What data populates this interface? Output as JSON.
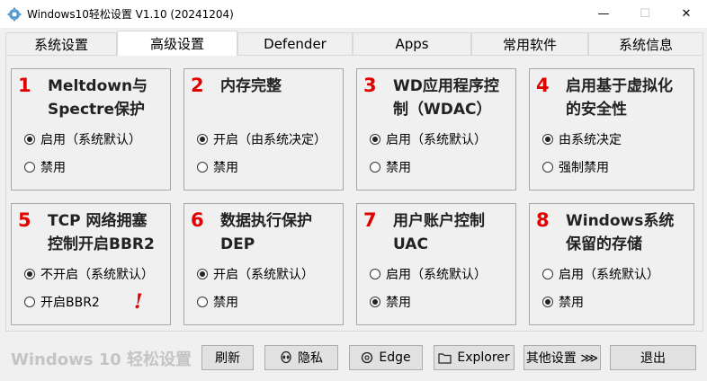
{
  "window": {
    "title": "Windows10轻松设置 V1.10  (20241204)",
    "minimize": "—",
    "maximize": "☐",
    "close": "✕"
  },
  "tabs": [
    {
      "label": "系统设置"
    },
    {
      "label": "高级设置"
    },
    {
      "label": "Defender"
    },
    {
      "label": "Apps"
    },
    {
      "label": "常用软件"
    },
    {
      "label": "系统信息"
    }
  ],
  "active_tab": "高级设置",
  "cards": [
    {
      "num": "1",
      "title_l1": "Meltdown与",
      "title_l2": "Spectre保护",
      "opt1": "启用（系统默认）",
      "opt2": "禁用",
      "selected": 1
    },
    {
      "num": "2",
      "title_l1": "内存完整",
      "title_l2": "",
      "opt1": "开启（由系统决定）",
      "opt2": "禁用",
      "selected": 1
    },
    {
      "num": "3",
      "title_l1": "WD应用程序控",
      "title_l2": "制（WDAC）",
      "opt1": "启用（系统默认）",
      "opt2": "禁用",
      "selected": 1
    },
    {
      "num": "4",
      "title_l1": "启用基于虚拟化",
      "title_l2": "的安全性",
      "opt1": "由系统决定",
      "opt2": "强制禁用",
      "selected": 1
    },
    {
      "num": "5",
      "title_l1": "TCP 网络拥塞",
      "title_l2": "控制开启BBR2",
      "opt1": "不开启（系统默认）",
      "opt2": "开启BBR2",
      "selected": 1,
      "warning": "!"
    },
    {
      "num": "6",
      "title_l1": "数据执行保护",
      "title_l2": "DEP",
      "opt1": "开启（系统默认）",
      "opt2": "禁用",
      "selected": 1
    },
    {
      "num": "7",
      "title_l1": "用户账户控制",
      "title_l2": "UAC",
      "opt1": "启用（系统默认）",
      "opt2": "禁用",
      "selected": 2
    },
    {
      "num": "8",
      "title_l1": "Windows系统",
      "title_l2": "保留的存储",
      "opt1": "启用（系统默认）",
      "opt2": "禁用",
      "selected": 2
    }
  ],
  "footer": {
    "brand": "Windows 10 轻松设置",
    "refresh": "刷新",
    "privacy": "隐私",
    "edge": "Edge",
    "explorer": "Explorer",
    "other": "其他设置 ⋙",
    "exit": "退出"
  },
  "colors": {
    "accent_red": "#e00000",
    "brand_gray": "#c4c4c4"
  }
}
